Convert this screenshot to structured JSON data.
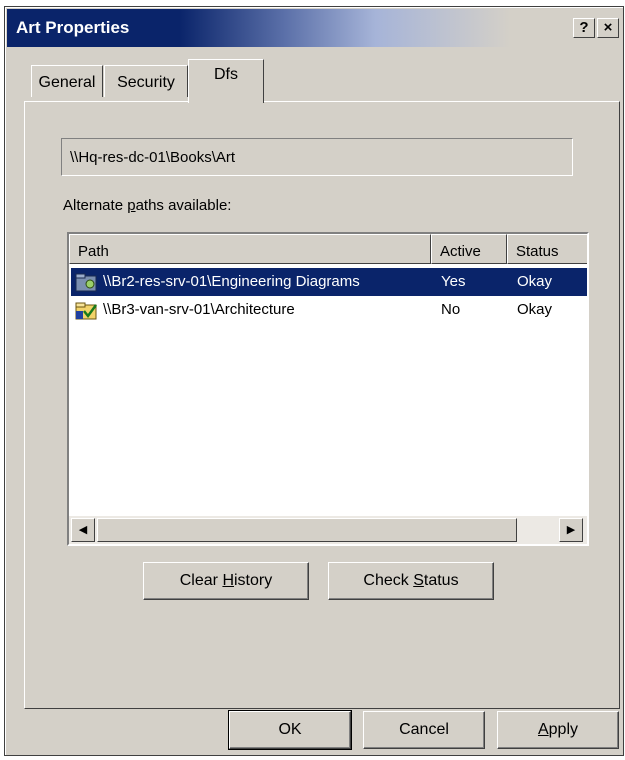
{
  "window": {
    "title": "Art Properties",
    "help_label": "?",
    "close_label": "×",
    "colors": {
      "titlebar_active": "#0a246a",
      "face": "#d4d0c8",
      "selection": "#0a246a"
    }
  },
  "tabs": [
    {
      "label": "General",
      "active": false
    },
    {
      "label": "Security",
      "active": false
    },
    {
      "label": "Dfs",
      "active": true
    }
  ],
  "dfs": {
    "path": "\\\\Hq-res-dc-01\\Books\\Art",
    "alt_label_pre": "Alternate ",
    "alt_label_key": "p",
    "alt_label_post": "aths available:",
    "columns": [
      "Path",
      "Active",
      "Status"
    ],
    "rows": [
      {
        "path": "\\\\Br2-res-srv-01\\Engineering Diagrams",
        "active": "Yes",
        "status": "Okay",
        "selected": true,
        "icon": "folder-share-icon"
      },
      {
        "path": "\\\\Br3-van-srv-01\\Architecture",
        "active": "No",
        "status": "Okay",
        "selected": false,
        "icon": "folder-check-icon"
      }
    ],
    "clear_history_pre": "Clear ",
    "clear_history_key": "H",
    "clear_history_post": "istory",
    "check_status_pre": "Check ",
    "check_status_key": "S",
    "check_status_post": "tatus"
  },
  "footer": {
    "ok": "OK",
    "cancel": "Cancel",
    "apply_key": "A",
    "apply_post": "pply"
  }
}
